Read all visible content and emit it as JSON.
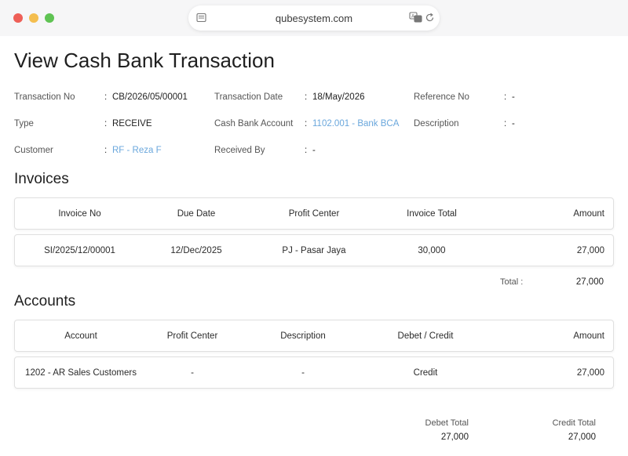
{
  "browser": {
    "url": "qubesystem.com"
  },
  "page": {
    "title": "View Cash Bank Transaction"
  },
  "info": {
    "transaction_no": {
      "label": "Transaction No",
      "value": "CB/2026/05/00001"
    },
    "transaction_date": {
      "label": "Transaction Date",
      "value": "18/May/2026"
    },
    "reference_no": {
      "label": "Reference No",
      "value": "-"
    },
    "type": {
      "label": "Type",
      "value": "RECEIVE"
    },
    "cash_bank_account": {
      "label": "Cash Bank Account",
      "value": "1102.001 - Bank BCA"
    },
    "description": {
      "label": "Description",
      "value": "-"
    },
    "customer": {
      "label": "Customer",
      "value": "RF - Reza F"
    },
    "received_by": {
      "label": "Received By",
      "value": "-"
    },
    "colon": ":"
  },
  "invoices": {
    "title": "Invoices",
    "headers": [
      "Invoice No",
      "Due Date",
      "Profit Center",
      "Invoice Total",
      "Amount"
    ],
    "rows": [
      [
        "SI/2025/12/00001",
        "12/Dec/2025",
        "PJ - Pasar Jaya",
        "30,000",
        "27,000"
      ]
    ],
    "total_label": "Total :",
    "total_value": "27,000"
  },
  "accounts": {
    "title": "Accounts",
    "headers": [
      "Account",
      "Profit Center",
      "Description",
      "Debet / Credit",
      "Amount"
    ],
    "rows": [
      [
        "1202 - AR Sales Customers",
        "-",
        "-",
        "Credit",
        "27,000"
      ]
    ]
  },
  "totals": {
    "debet_label": "Debet Total",
    "debet_value": "27,000",
    "credit_label": "Credit Total",
    "credit_value": "27,000"
  },
  "colors": {
    "link": "#6aa7dc",
    "close": "#ee5f57",
    "minimize": "#f4be4f",
    "maximize": "#5fc353"
  }
}
